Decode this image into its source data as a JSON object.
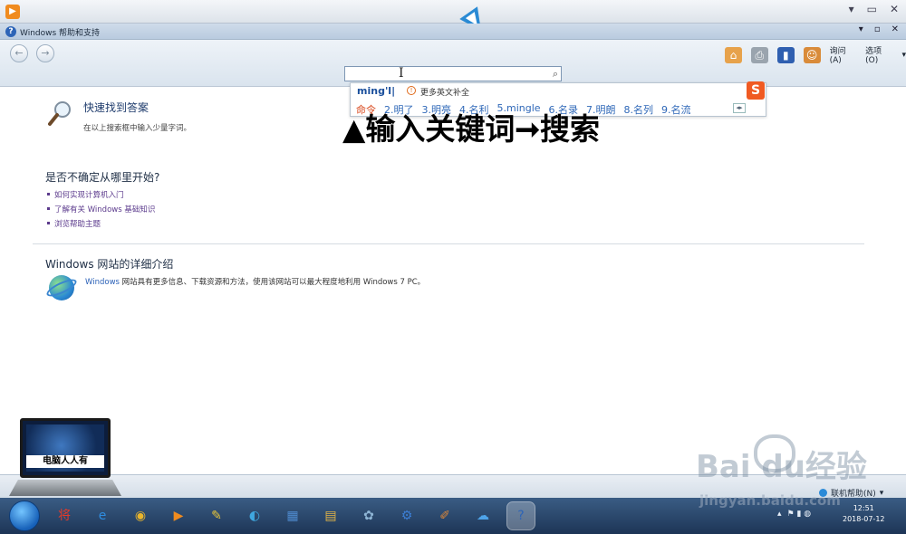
{
  "window": {
    "title": "Windows 帮助和支持",
    "minimize": "▾",
    "restore": "▫",
    "close": "✕"
  },
  "player": {
    "logo": "▶",
    "ctrl_min": "▾",
    "ctrl_max": "▭",
    "ctrl_close": "✕"
  },
  "toolbar": {
    "back": "←",
    "forward": "→",
    "ask_label": "询问(A)",
    "options_label": "选项(O)",
    "options_arrow": "▾"
  },
  "search": {
    "value": "",
    "search_glyph": "⌕"
  },
  "ime": {
    "composition": "ming'l|",
    "more_icon": "!",
    "more_label": "更多英文补全",
    "candidates": [
      "命令",
      "2.明了",
      "3.明亮",
      "4.名利",
      "5.mingle",
      "6.名录",
      "7.明朗",
      "8.名列",
      "9.名流"
    ],
    "pager": "◂▸",
    "sogou_logo": "S"
  },
  "overlay": {
    "caption": "▲输入关键词➞搜索"
  },
  "quick": {
    "title": "快速找到答案",
    "desc": "在以上搜索框中输入少量字词。"
  },
  "unsure": {
    "title": "是否不确定从哪里开始?",
    "links": [
      "如何实现计算机入门",
      "了解有关 Windows 基础知识",
      "浏览帮助主题"
    ]
  },
  "web": {
    "title": "Windows 网站的详细介绍",
    "desc_link": "Windows",
    "desc_rest": " 网站具有更多信息、下载资源和方法，使用该网站可以最大程度地利用 Windows 7 PC。"
  },
  "statusbar": {
    "online_help": "联机帮助(N)",
    "online_arrow": "▾"
  },
  "taskbar": {
    "tasks": [
      {
        "name": "360-browser-icon",
        "glyph": "将",
        "color": "#e23a2a"
      },
      {
        "name": "ie-icon",
        "glyph": "e",
        "color": "#2f8de0"
      },
      {
        "name": "chrome-icon",
        "glyph": "◉",
        "color": "#e9b52c"
      },
      {
        "name": "media-player-icon",
        "glyph": "▶",
        "color": "#f08b1f"
      },
      {
        "name": "notes-icon",
        "glyph": "✎",
        "color": "#e7c53a"
      },
      {
        "name": "browser-icon",
        "glyph": "◐",
        "color": "#3fa7e0"
      },
      {
        "name": "control-panel-icon",
        "glyph": "▦",
        "color": "#4f8bcf"
      },
      {
        "name": "folder-icon",
        "glyph": "▤",
        "color": "#e2b448"
      },
      {
        "name": "recycle-icon",
        "glyph": "✿",
        "color": "#8fb6d6"
      },
      {
        "name": "connect-icon",
        "glyph": "⚙",
        "color": "#3c7fd6"
      },
      {
        "name": "paint-icon",
        "glyph": "✐",
        "color": "#d9863a"
      },
      {
        "name": "cloud-icon",
        "glyph": "☁",
        "color": "#4ea3e8"
      },
      {
        "name": "help-icon",
        "glyph": "?",
        "color": "#2d64b7"
      }
    ],
    "clock_time": "12:51",
    "clock_date": "2018-07-12",
    "tray_arrow": "▴",
    "tray_icons": "⚑ ▮ ◍"
  },
  "laptop_logo": {
    "label": "电脑人人有"
  },
  "watermark": {
    "text": "Bai  du经验",
    "url": "jingyan.baidu.com"
  }
}
